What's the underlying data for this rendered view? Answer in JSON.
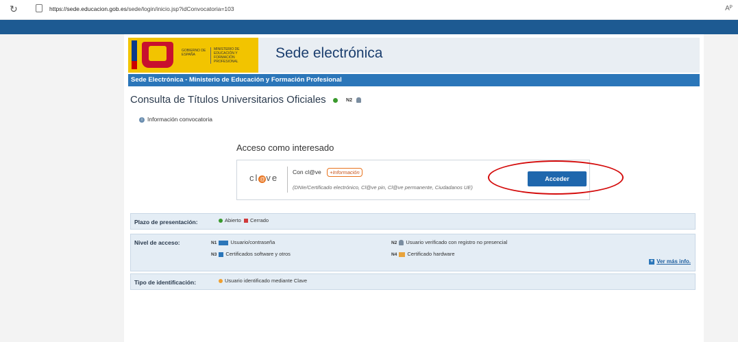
{
  "browser": {
    "url_host": "https://sede.educacion.gob.es",
    "url_path": "/sede/login/inicio.jsp?idConvocatoria=103",
    "reader_icon": "Aᴾ"
  },
  "banner": {
    "gobierno": "GOBIERNO DE ESPAÑA",
    "ministerio": "MINISTERIO DE EDUCACIÓN Y FORMACIÓN PROFESIONAL",
    "title": "Sede electrónica"
  },
  "navbar": {
    "text": "Sede Electrónica - Ministerio de Educación y Formación Profesional"
  },
  "page": {
    "title": "Consulta de Títulos Universitarios Oficiales",
    "level_badge": "N2",
    "info_link": "Información convocatoria"
  },
  "access": {
    "title": "Acceso como interesado",
    "logo_pre": "cl",
    "logo_o": "@",
    "logo_post": "ve",
    "con_label": "Con cl@ve",
    "mas_info": "+Información",
    "subtitle": "(DNIe/Certificado electrónico, Cl@ve pin, Cl@ve permanente, Ciudadanos UE)",
    "button": "Acceder"
  },
  "plazo": {
    "label": "Plazo de presentación:",
    "abierto": "Abierto",
    "cerrado": "Cerrado"
  },
  "nivel": {
    "label": "Nivel de acceso:",
    "n1_badge": "N1",
    "n1": "Usuario/contraseña",
    "n2_badge": "N2",
    "n2": "Usuario verificado con registro no presencial",
    "n3_badge": "N3",
    "n3": "Certificados software y otros",
    "n4_badge": "N4",
    "n4": "Certificado hardware",
    "ver_mas": "Ver más info."
  },
  "tipo": {
    "label": "Tipo de identificación:",
    "value": "Usuario identificado mediante Clave"
  },
  "colors": {
    "accent": "#2b76b9",
    "topstrip": "#1d5a92",
    "highlight": "#d40c0c"
  }
}
